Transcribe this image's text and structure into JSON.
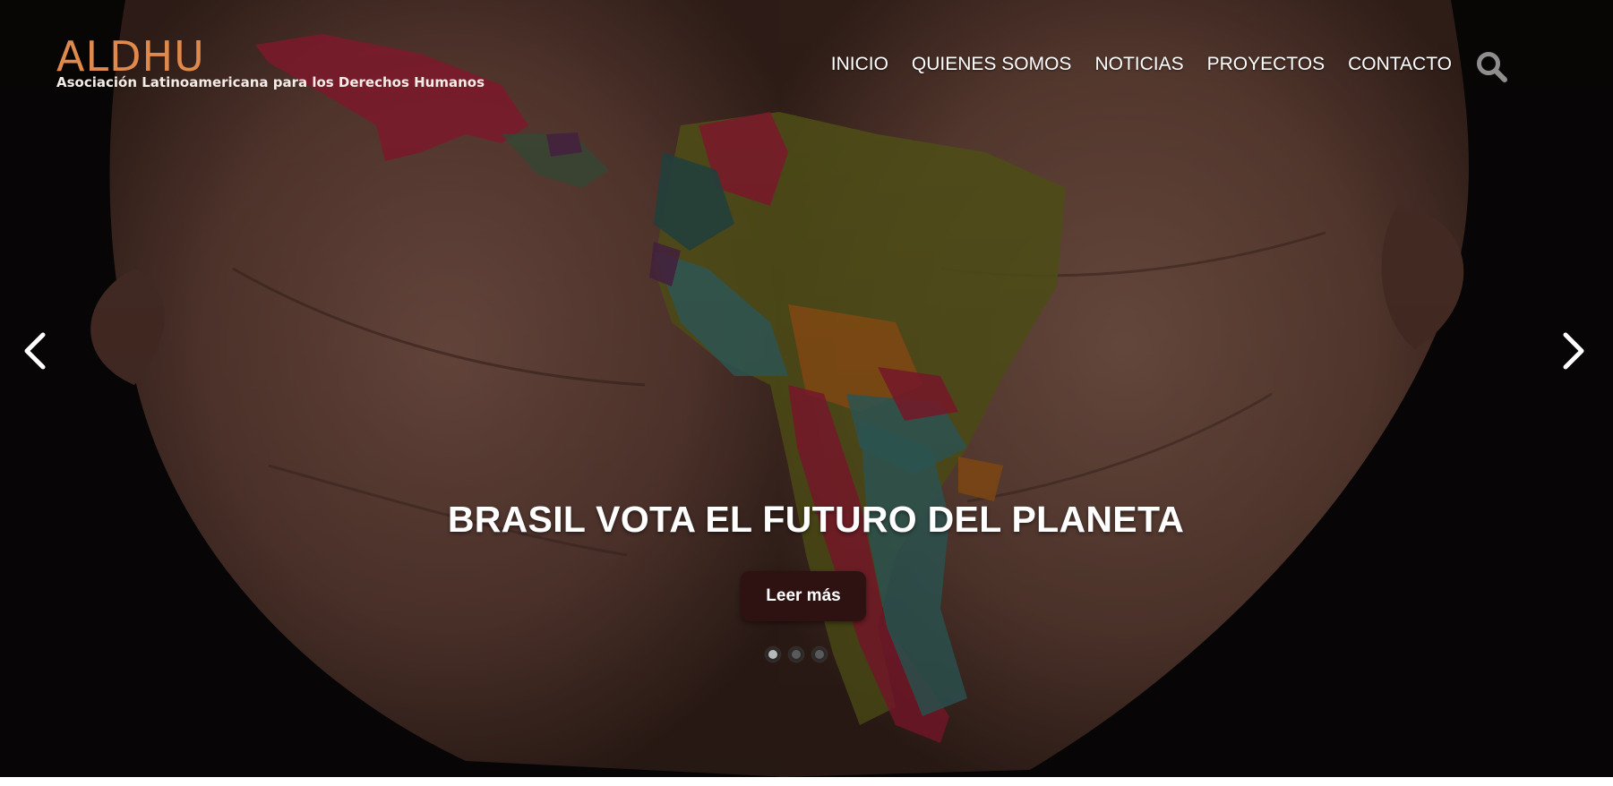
{
  "brand": {
    "name": "ALDHU",
    "tagline": "Asociación Latinoamericana para los Derechos Humanos",
    "accent_color": "#e0894d"
  },
  "nav": {
    "items": [
      {
        "label": "INICIO"
      },
      {
        "label": "QUIENES SOMOS"
      },
      {
        "label": "NOTICIAS"
      },
      {
        "label": "PROYECTOS"
      },
      {
        "label": "CONTACTO"
      }
    ],
    "search_icon": "search-icon"
  },
  "slider": {
    "title": "BRASIL VOTA EL FUTURO DEL PLANETA",
    "button_label": "Leer más",
    "button_color": "#2e1212",
    "active_index": 0,
    "slides_count": 3,
    "prev_icon": "chevron-left-icon",
    "next_icon": "chevron-right-icon",
    "dot_active_color": "#b9b9b9",
    "dot_inactive_color": "#5a5a5a"
  }
}
